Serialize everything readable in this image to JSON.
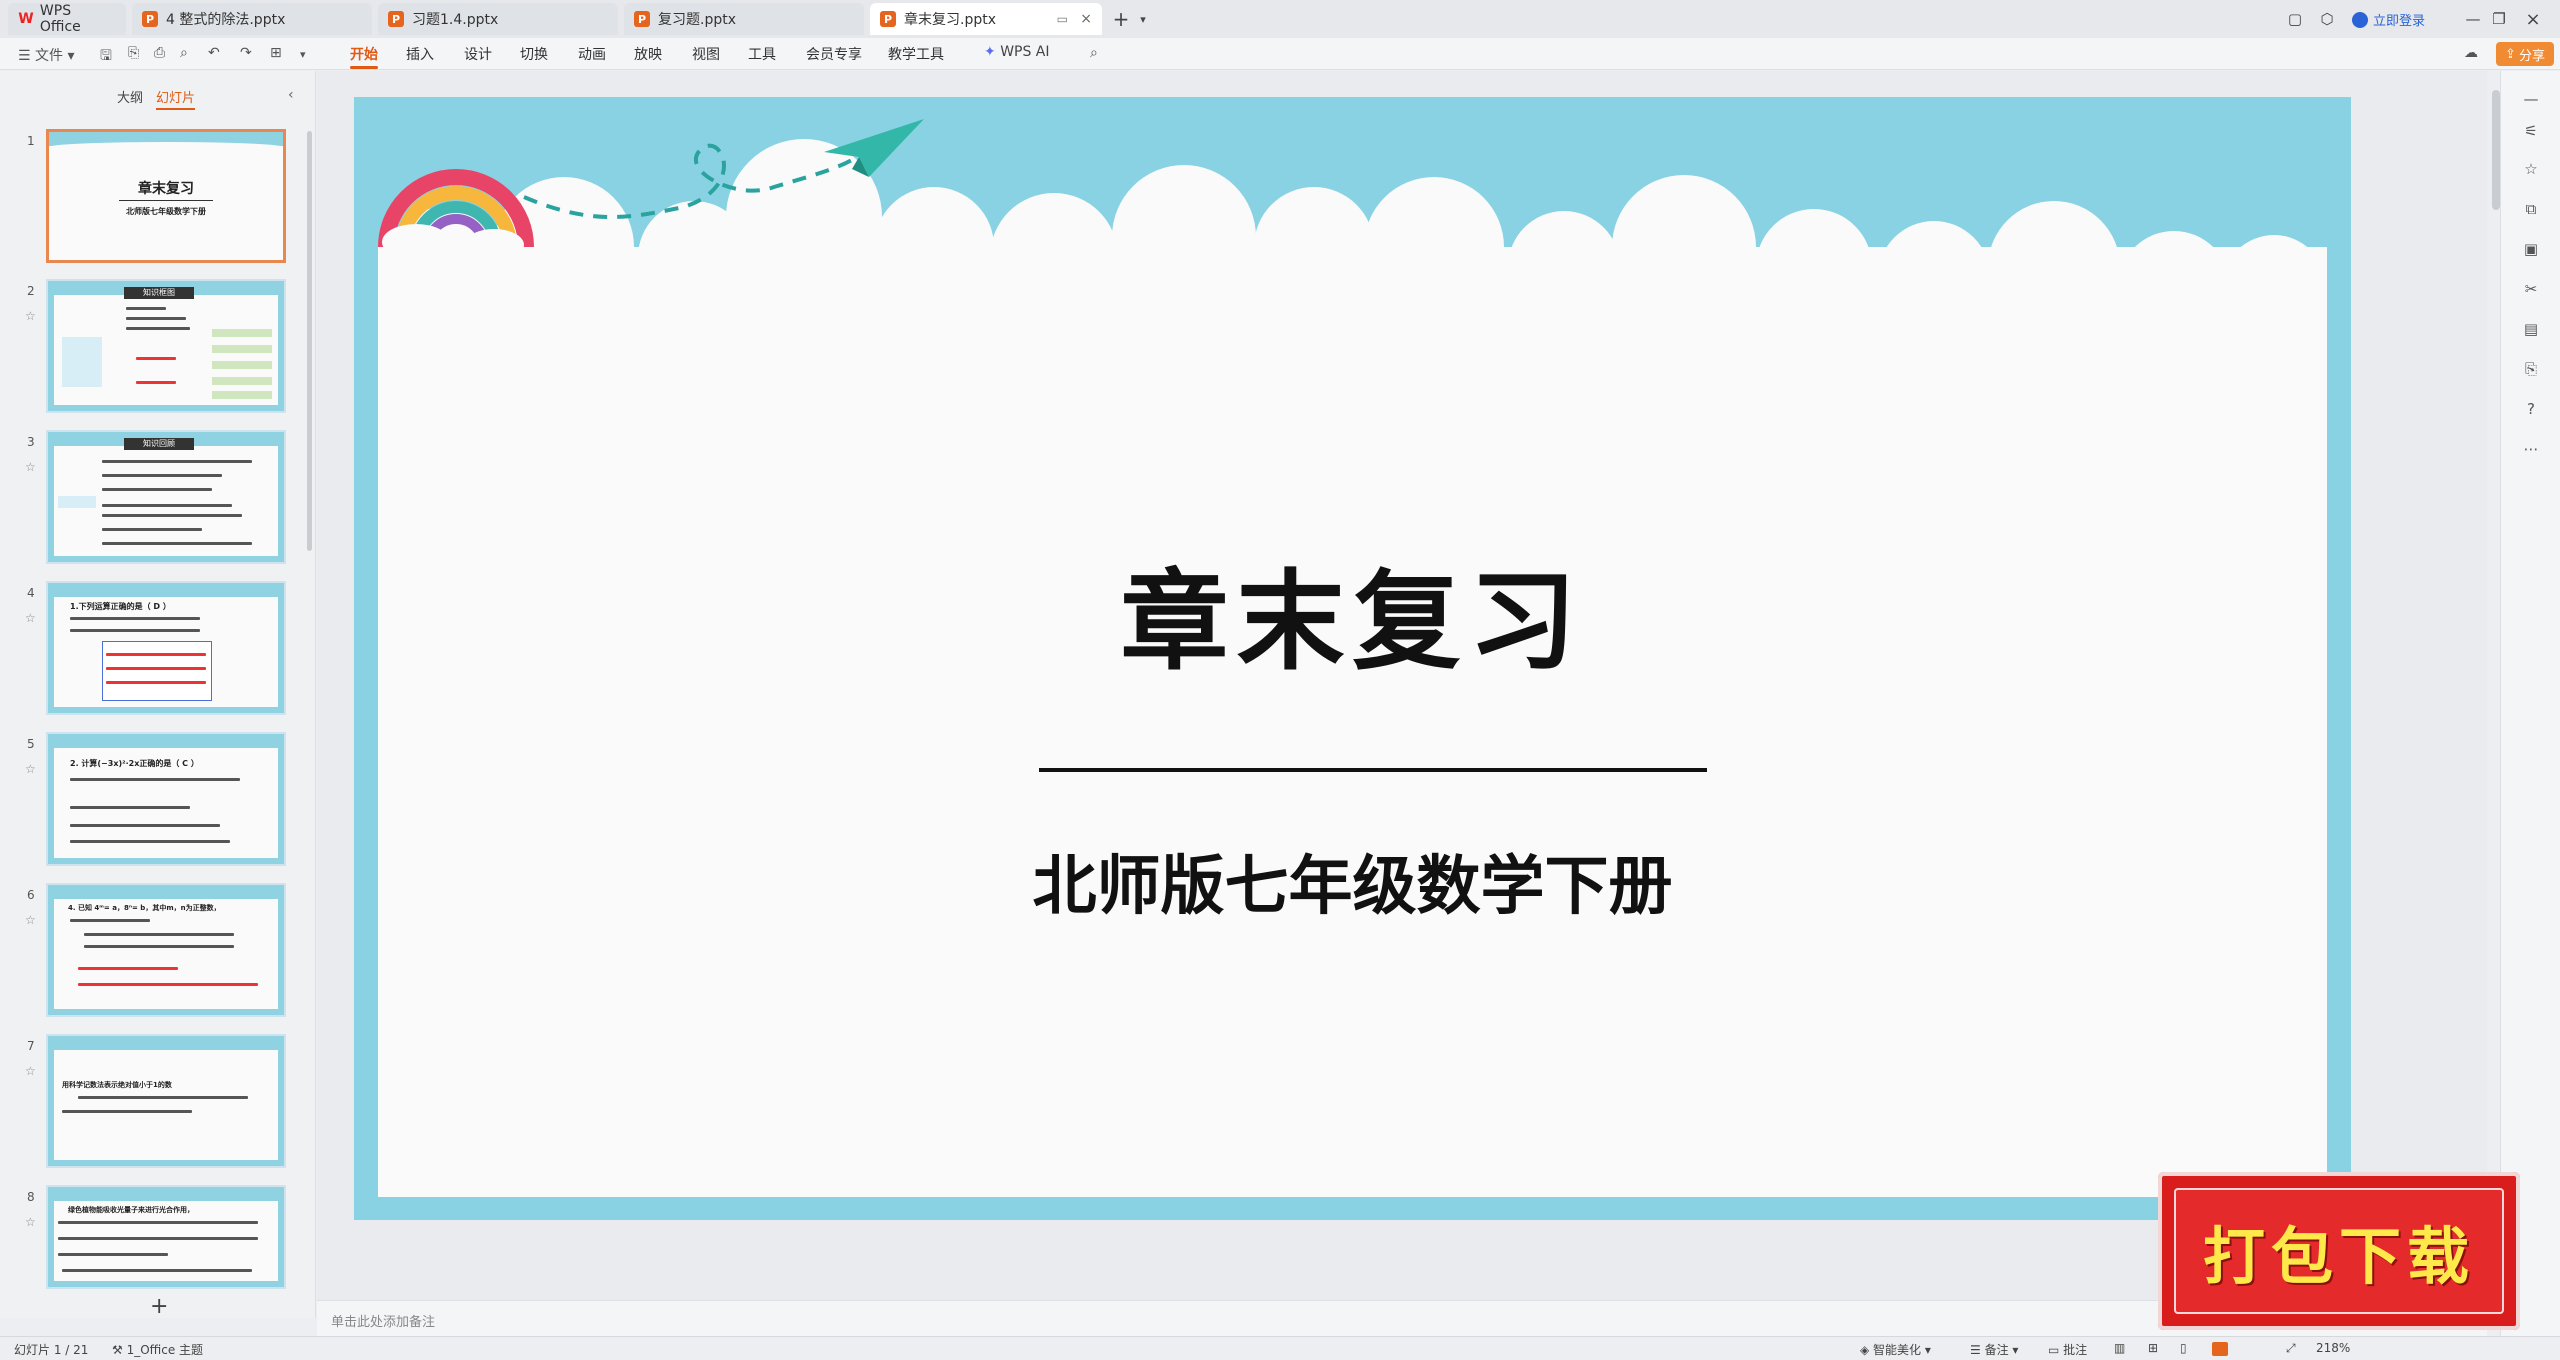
{
  "titlebar": {
    "tabs": [
      {
        "label": "WPS Office"
      },
      {
        "label": "4   整式的除法.pptx"
      },
      {
        "label": "习题1.4.pptx"
      },
      {
        "label": "复习题.pptx"
      },
      {
        "label": "章末复习.pptx"
      }
    ],
    "login": "立即登录"
  },
  "ribbon": {
    "file": "文件",
    "menus": [
      "开始",
      "插入",
      "设计",
      "切换",
      "动画",
      "放映",
      "视图",
      "工具",
      "会员专享",
      "教学工具",
      "WPS AI"
    ],
    "share": "分享"
  },
  "leftpanel": {
    "tabs": [
      "大纲",
      "幻灯片"
    ],
    "thumbnails": [
      {
        "num": "1",
        "title": "章末复习",
        "subtitle": "北师版七年级数学下册"
      },
      {
        "num": "2",
        "title": "知识框图"
      },
      {
        "num": "3",
        "title": "知识回顾"
      },
      {
        "num": "4",
        "title": "1.下列运算正确的是（  D  ）"
      },
      {
        "num": "5",
        "title": "2. 计算(−3x)²·2x正确的是（  C  ）"
      },
      {
        "num": "6",
        "title": "4. 已知 4ᵐ= a，8ⁿ= b，其中m，n为正整数，"
      },
      {
        "num": "7",
        "title": "用科学记数法表示绝对值小于1的数"
      },
      {
        "num": "8",
        "title": "绿色植物能吸收光量子来进行光合作用，"
      }
    ]
  },
  "slide": {
    "title": "章末复习",
    "subtitle": "北师版七年级数学下册"
  },
  "notes": {
    "placeholder": "单击此处添加备注"
  },
  "status": {
    "slide_info": "幻灯片 1 / 21",
    "theme": "1_Office 主题",
    "beautify": "智能美化",
    "notes": "备注",
    "comment": "批注",
    "zoom": "218%"
  },
  "banner": {
    "text": "打包下载"
  },
  "colors": {
    "accent": "#e05a13",
    "sky": "#89d2e3",
    "banner": "#d91d1d"
  }
}
